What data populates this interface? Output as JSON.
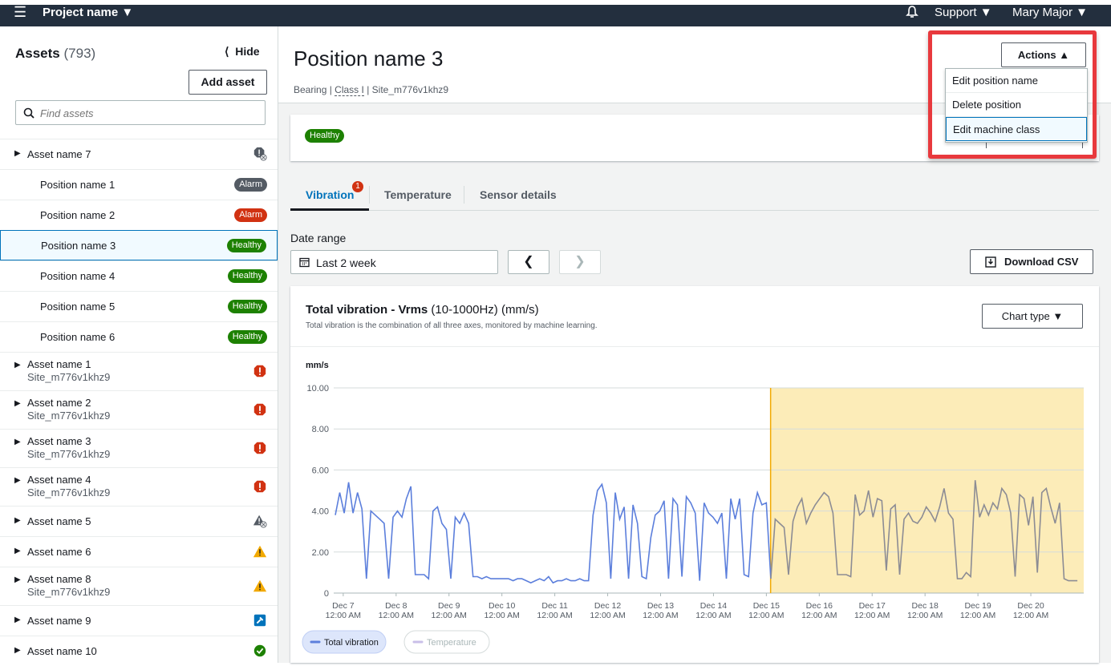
{
  "topbar": {
    "menu_icon": "hamburger-icon",
    "project": "Project name ▼",
    "support": "Support ▼",
    "user": "Mary Major ▼"
  },
  "sidebar": {
    "title": "Assets",
    "count": "(793)",
    "hide": "Hide",
    "add_asset": "Add asset",
    "search_placeholder": "Find assets",
    "items": [
      {
        "type": "asset",
        "name": "Asset name 7",
        "sub": "",
        "status": "warning-offline",
        "h": 38
      },
      {
        "type": "position",
        "name": "Position name 1",
        "badge": "Alarm",
        "badge_color": "grey",
        "h": 38
      },
      {
        "type": "position",
        "name": "Position name 2",
        "badge": "Alarm",
        "badge_color": "red",
        "h": 38
      },
      {
        "type": "position",
        "name": "Position name 3",
        "badge": "Healthy",
        "badge_color": "green",
        "h": 38,
        "selected": true
      },
      {
        "type": "position",
        "name": "Position name 4",
        "badge": "Healthy",
        "badge_color": "green",
        "h": 38
      },
      {
        "type": "position",
        "name": "Position name 5",
        "badge": "Healthy",
        "badge_color": "green",
        "h": 38
      },
      {
        "type": "position",
        "name": "Position name 6",
        "badge": "Healthy",
        "badge_color": "green",
        "h": 38
      },
      {
        "type": "asset",
        "name": "Asset name 1",
        "sub": "Site_m776v1khz9",
        "status": "alarm",
        "h": 48
      },
      {
        "type": "asset",
        "name": "Asset name 2",
        "sub": "Site_m776v1khz9",
        "status": "alarm",
        "h": 48
      },
      {
        "type": "asset",
        "name": "Asset name 3",
        "sub": "Site_m776v1khz9",
        "status": "alarm",
        "h": 48
      },
      {
        "type": "asset",
        "name": "Asset name 4",
        "sub": "Site_m776v1khz9",
        "status": "alarm",
        "h": 48
      },
      {
        "type": "asset",
        "name": "Asset name 5",
        "sub": "",
        "status": "grey-warning",
        "h": 38
      },
      {
        "type": "asset",
        "name": "Asset name 6",
        "sub": "",
        "status": "warning",
        "h": 38
      },
      {
        "type": "asset",
        "name": "Asset name 8",
        "sub": "Site_m776v1khz9",
        "status": "warning",
        "h": 48
      },
      {
        "type": "asset",
        "name": "Asset name 9",
        "sub": "",
        "status": "maintenance",
        "h": 38
      },
      {
        "type": "asset",
        "name": "Asset name 10",
        "sub": "",
        "status": "ok",
        "h": 38
      }
    ]
  },
  "main": {
    "title": "Position name 3",
    "sub_type": "Bearing",
    "sub_class": "Class I",
    "sub_site": "Site_m776v1khz9",
    "status_badge": "Healthy",
    "actions": "Actions ▲",
    "menu": [
      "Edit position name",
      "Delete position",
      "Edit machine class"
    ],
    "tabs": [
      "Vibration",
      "Temperature",
      "Sensor details"
    ],
    "tab_alert": "1",
    "date_range_label": "Date range",
    "date_range_value": "Last 2 week",
    "download": "Download CSV",
    "chart_title_bold": "Total vibration - Vrms",
    "chart_title_rest": " (10-1000Hz) (mm/s)",
    "chart_desc": "Total vibration is the combination of all three axes, monitored by machine learning.",
    "chart_type": "Chart type ▼"
  },
  "chart_data": {
    "type": "line",
    "ylabel": "mm/s",
    "ylim": [
      0,
      10
    ],
    "yticks": [
      "0",
      "2.00",
      "4.00",
      "6.00",
      "8.00",
      "10.00"
    ],
    "xticks": [
      {
        "d": "Dec 7",
        "t": "12:00 AM"
      },
      {
        "d": "Dec 8",
        "t": "12:00 AM"
      },
      {
        "d": "Dec 9",
        "t": "12:00 AM"
      },
      {
        "d": "Dec 10",
        "t": "12:00 AM"
      },
      {
        "d": "Dec 11",
        "t": "12:00 AM"
      },
      {
        "d": "Dec 12",
        "t": "12:00 AM"
      },
      {
        "d": "Dec 13",
        "t": "12:00 AM"
      },
      {
        "d": "Dec 14",
        "t": "12:00 AM"
      },
      {
        "d": "Dec 15",
        "t": "12:00 AM"
      },
      {
        "d": "Dec 16",
        "t": "12:00 AM"
      },
      {
        "d": "Dec 17",
        "t": "12:00 AM"
      },
      {
        "d": "Dec 18",
        "t": "12:00 AM"
      },
      {
        "d": "Dec 19",
        "t": "12:00 AM"
      },
      {
        "d": "Dec 20",
        "t": "12:00 AM"
      }
    ],
    "x_start_day": 6.82,
    "x_end_day": 21.0,
    "highlight_from_day": 15.08,
    "series_colors": {
      "Total vibration": "#5c7fdc",
      "highlighted": "#8c8c94",
      "highlight_fill": "#fcecb8",
      "highlight_line": "#f2a900"
    },
    "legend": [
      "Total vibration",
      "Temperature"
    ],
    "series": [
      {
        "name": "Total vibration",
        "values": [
          3.8,
          4.9,
          3.9,
          5.4,
          3.9,
          4.9,
          4.1,
          0.7,
          4.0,
          3.8,
          3.6,
          3.4,
          0.7,
          3.7,
          4.0,
          3.7,
          4.6,
          5.2,
          0.9,
          0.9,
          0.9,
          0.7,
          4.0,
          4.2,
          3.4,
          3.1,
          0.7,
          3.7,
          3.4,
          3.9,
          3.4,
          0.8,
          0.8,
          0.7,
          0.8,
          0.7,
          0.7,
          0.7,
          0.7,
          0.7,
          0.6,
          0.7,
          0.7,
          0.6,
          0.5,
          0.6,
          0.7,
          0.6,
          0.8,
          0.5,
          0.6,
          0.6,
          0.7,
          0.6,
          0.6,
          0.7,
          0.6,
          0.6,
          3.8,
          5.0,
          5.3,
          4.4,
          0.7,
          4.9,
          3.6,
          4.2,
          0.7,
          4.3,
          3.4,
          0.8,
          0.7,
          2.7,
          3.8,
          4.0,
          4.5,
          0.7,
          4.6,
          4.3,
          0.8,
          4.7,
          4.4,
          3.9,
          0.6,
          4.4,
          3.9,
          3.7,
          3.4,
          3.9,
          0.7,
          4.6,
          3.6,
          4.6,
          0.9,
          0.8,
          3.9,
          4.9,
          4.3,
          4.4,
          0.7,
          3.6,
          3.4,
          3.2,
          0.9,
          3.5,
          4.2,
          4.6,
          3.4,
          3.9,
          4.3,
          4.6,
          4.9,
          4.7,
          3.9,
          0.9,
          0.9,
          0.9,
          0.8,
          4.8,
          3.8,
          4.0,
          5.0,
          3.7,
          4.6,
          4.5,
          1.1,
          4.1,
          4.3,
          0.9,
          3.6,
          3.9,
          3.5,
          3.4,
          3.7,
          4.2,
          3.9,
          3.5,
          4.2,
          5.1,
          3.9,
          3.6,
          0.7,
          0.7,
          1.0,
          0.8,
          5.5,
          3.7,
          4.3,
          3.8,
          4.4,
          4.1,
          5.1,
          4.8,
          3.9,
          0.8,
          4.8,
          4.6,
          3.3,
          4.7,
          1.0,
          4.9,
          5.1,
          4.2,
          3.4,
          4.4,
          0.7,
          0.6,
          0.6,
          0.6
        ]
      }
    ]
  }
}
